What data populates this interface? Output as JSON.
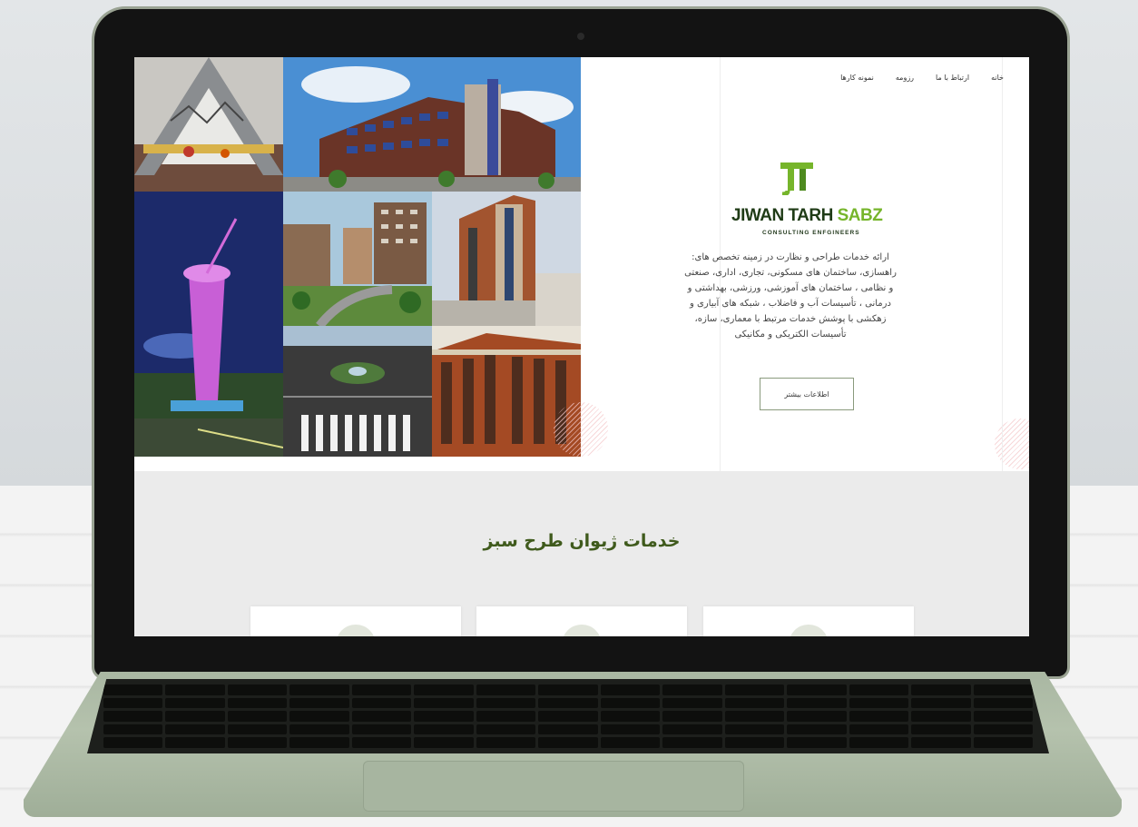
{
  "nav": {
    "items": [
      "خانه",
      "ارتباط با ما",
      "رزومه",
      "نمونه کارها"
    ]
  },
  "brand": {
    "name_main": "JIWAN TARH",
    "name_accent": "SABZ",
    "subtitle": "CONSULTING ENFGINEERS",
    "logo_icon": "jt-logo-icon"
  },
  "hero": {
    "description_lines": [
      "ارائه خدمات طراحی و نظارت در زمینه تخصص های:",
      "راهسازی، ساختمان های مسکونی، تجاری، اداری، صنعتی",
      "و نظامی ، ساختمان های آموزشی، ورزشی، بهداشتی و",
      "درمانی ، تأسیسات آب و فاضلاب ، شبکه های آبیاری و",
      "زهکشی با پوشش خدمات مرتبط با معماری، سازه،",
      "تأسیسات الکتریکی و مکانیکی"
    ],
    "more_button": "اطلاعات بیشتر"
  },
  "services": {
    "title": "خدمات ژیوان طرح سبز",
    "cards": 3
  },
  "colors": {
    "brand_dark": "#1f3b16",
    "brand_green": "#76b52b",
    "title_green": "#3f5a1c",
    "laptop_body": "#a9b7a2"
  }
}
